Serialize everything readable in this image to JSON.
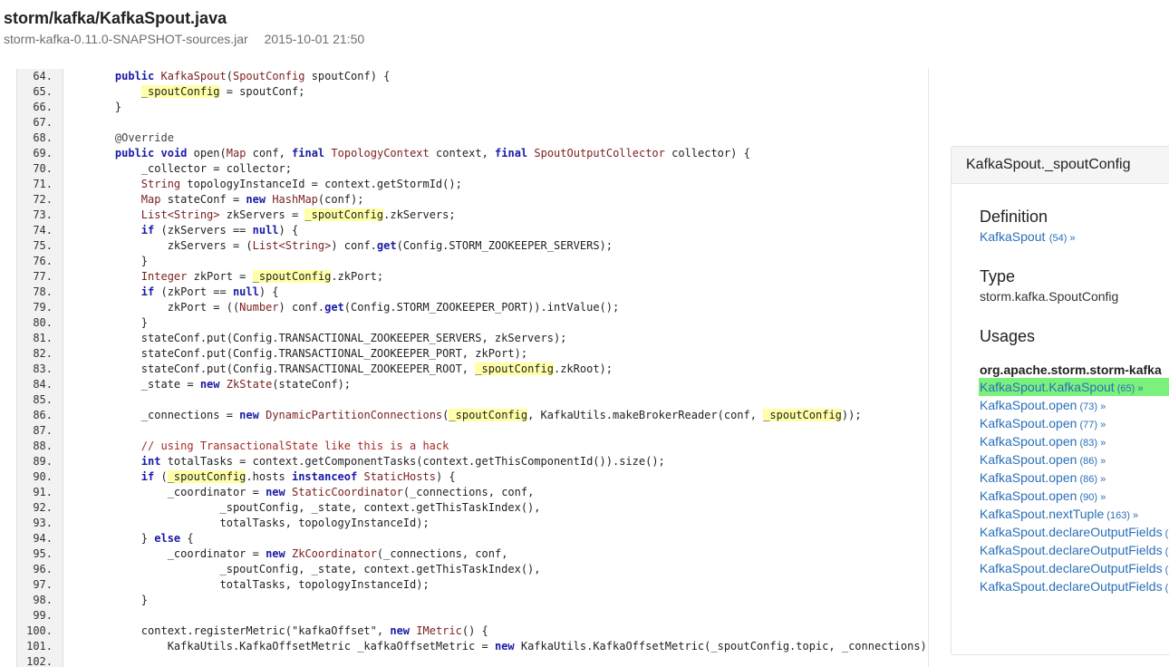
{
  "file": {
    "title": "storm/kafka/KafkaSpout.java",
    "jar": "storm-kafka-0.11.0-SNAPSHOT-sources.jar",
    "date": "2015-10-01 21:50"
  },
  "code_lines": [
    {
      "n": "64.",
      "t": [
        [
          "    "
        ],
        [
          "public",
          "kw"
        ],
        [
          " "
        ],
        [
          "KafkaSpout",
          "ty"
        ],
        [
          "("
        ],
        [
          "SpoutConfig",
          "ty"
        ],
        [
          " spoutConf) {"
        ]
      ]
    },
    {
      "n": "65.",
      "t": [
        [
          "        "
        ],
        [
          "_spoutConfig",
          "hl"
        ],
        [
          " = spoutConf;"
        ]
      ]
    },
    {
      "n": "66.",
      "t": [
        [
          "    }"
        ]
      ]
    },
    {
      "n": "67.",
      "t": [
        [
          ""
        ]
      ]
    },
    {
      "n": "68.",
      "t": [
        [
          "    "
        ],
        [
          "@Override",
          "an"
        ]
      ]
    },
    {
      "n": "69.",
      "t": [
        [
          "    "
        ],
        [
          "public",
          "kw"
        ],
        [
          " "
        ],
        [
          "void",
          "kw"
        ],
        [
          " open("
        ],
        [
          "Map",
          "ty"
        ],
        [
          " conf, "
        ],
        [
          "final",
          "kw"
        ],
        [
          " "
        ],
        [
          "TopologyContext",
          "ty"
        ],
        [
          " context, "
        ],
        [
          "final",
          "kw"
        ],
        [
          " "
        ],
        [
          "SpoutOutputCollector",
          "ty"
        ],
        [
          " collector) {"
        ]
      ]
    },
    {
      "n": "70.",
      "t": [
        [
          "        _collector = collector;"
        ]
      ]
    },
    {
      "n": "71.",
      "t": [
        [
          "        "
        ],
        [
          "String",
          "ty"
        ],
        [
          " topologyInstanceId = context.getStormId();"
        ]
      ]
    },
    {
      "n": "72.",
      "t": [
        [
          "        "
        ],
        [
          "Map",
          "ty"
        ],
        [
          " stateConf = "
        ],
        [
          "new",
          "kw"
        ],
        [
          " "
        ],
        [
          "HashMap",
          "ty"
        ],
        [
          "(conf);"
        ]
      ]
    },
    {
      "n": "73.",
      "t": [
        [
          "        "
        ],
        [
          "List<String>",
          "ty"
        ],
        [
          " zkServers = "
        ],
        [
          "_spoutConfig",
          "hl"
        ],
        [
          ".zkServers;"
        ]
      ]
    },
    {
      "n": "74.",
      "t": [
        [
          "        "
        ],
        [
          "if",
          "kw"
        ],
        [
          " (zkServers == "
        ],
        [
          "null",
          "kw"
        ],
        [
          ") {"
        ]
      ]
    },
    {
      "n": "75.",
      "t": [
        [
          "            zkServers = ("
        ],
        [
          "List<String>",
          "ty"
        ],
        [
          ") conf."
        ],
        [
          "get",
          "kw"
        ],
        [
          "(Config.STORM_ZOOKEEPER_SERVERS);"
        ]
      ]
    },
    {
      "n": "76.",
      "t": [
        [
          "        }"
        ]
      ]
    },
    {
      "n": "77.",
      "t": [
        [
          "        "
        ],
        [
          "Integer",
          "ty"
        ],
        [
          " zkPort = "
        ],
        [
          "_spoutConfig",
          "hl"
        ],
        [
          ".zkPort;"
        ]
      ]
    },
    {
      "n": "78.",
      "t": [
        [
          "        "
        ],
        [
          "if",
          "kw"
        ],
        [
          " (zkPort == "
        ],
        [
          "null",
          "kw"
        ],
        [
          ") {"
        ]
      ]
    },
    {
      "n": "79.",
      "t": [
        [
          "            zkPort = (("
        ],
        [
          "Number",
          "ty"
        ],
        [
          ") conf."
        ],
        [
          "get",
          "kw"
        ],
        [
          "(Config.STORM_ZOOKEEPER_PORT)).intValue();"
        ]
      ]
    },
    {
      "n": "80.",
      "t": [
        [
          "        }"
        ]
      ]
    },
    {
      "n": "81.",
      "t": [
        [
          "        stateConf.put(Config.TRANSACTIONAL_ZOOKEEPER_SERVERS, zkServers);"
        ]
      ]
    },
    {
      "n": "82.",
      "t": [
        [
          "        stateConf.put(Config.TRANSACTIONAL_ZOOKEEPER_PORT, zkPort);"
        ]
      ]
    },
    {
      "n": "83.",
      "t": [
        [
          "        stateConf.put(Config.TRANSACTIONAL_ZOOKEEPER_ROOT, "
        ],
        [
          "_spoutConfig",
          "hl"
        ],
        [
          ".zkRoot);"
        ]
      ]
    },
    {
      "n": "84.",
      "t": [
        [
          "        _state = "
        ],
        [
          "new",
          "kw"
        ],
        [
          " "
        ],
        [
          "ZkState",
          "ty"
        ],
        [
          "(stateConf);"
        ]
      ]
    },
    {
      "n": "85.",
      "t": [
        [
          ""
        ]
      ]
    },
    {
      "n": "86.",
      "t": [
        [
          "        _connections = "
        ],
        [
          "new",
          "kw"
        ],
        [
          " "
        ],
        [
          "DynamicPartitionConnections",
          "ty"
        ],
        [
          "("
        ],
        [
          "_spoutConfig",
          "hl"
        ],
        [
          ", KafkaUtils.makeBrokerReader(conf, "
        ],
        [
          "_spoutConfig",
          "hl"
        ],
        [
          "));"
        ]
      ]
    },
    {
      "n": "87.",
      "t": [
        [
          ""
        ]
      ]
    },
    {
      "n": "88.",
      "t": [
        [
          "        "
        ],
        [
          "// using TransactionalState like this is a hack",
          "cm"
        ]
      ]
    },
    {
      "n": "89.",
      "t": [
        [
          "        "
        ],
        [
          "int",
          "kw"
        ],
        [
          " totalTasks = context.getComponentTasks(context.getThisComponentId()).size();"
        ]
      ]
    },
    {
      "n": "90.",
      "t": [
        [
          "        "
        ],
        [
          "if",
          "kw"
        ],
        [
          " ("
        ],
        [
          "_spoutConfig",
          "hl"
        ],
        [
          ".hosts "
        ],
        [
          "instanceof",
          "kw"
        ],
        [
          " "
        ],
        [
          "StaticHosts",
          "ty"
        ],
        [
          ") {"
        ]
      ]
    },
    {
      "n": "91.",
      "t": [
        [
          "            _coordinator = "
        ],
        [
          "new",
          "kw"
        ],
        [
          " "
        ],
        [
          "StaticCoordinator",
          "ty"
        ],
        [
          "(_connections, conf,"
        ]
      ]
    },
    {
      "n": "92.",
      "t": [
        [
          "                    _spoutConfig, _state, context.getThisTaskIndex(),"
        ]
      ]
    },
    {
      "n": "93.",
      "t": [
        [
          "                    totalTasks, topologyInstanceId);"
        ]
      ]
    },
    {
      "n": "94.",
      "t": [
        [
          "        } "
        ],
        [
          "else",
          "kw"
        ],
        [
          " {"
        ]
      ]
    },
    {
      "n": "95.",
      "t": [
        [
          "            _coordinator = "
        ],
        [
          "new",
          "kw"
        ],
        [
          " "
        ],
        [
          "ZkCoordinator",
          "ty"
        ],
        [
          "(_connections, conf,"
        ]
      ]
    },
    {
      "n": "96.",
      "t": [
        [
          "                    _spoutConfig, _state, context.getThisTaskIndex(),"
        ]
      ]
    },
    {
      "n": "97.",
      "t": [
        [
          "                    totalTasks, topologyInstanceId);"
        ]
      ]
    },
    {
      "n": "98.",
      "t": [
        [
          "        }"
        ]
      ]
    },
    {
      "n": "99.",
      "t": [
        [
          ""
        ]
      ]
    },
    {
      "n": "100.",
      "t": [
        [
          "        context.registerMetric(\"kafkaOffset\", "
        ],
        [
          "new",
          "kw"
        ],
        [
          " "
        ],
        [
          "IMetric",
          "ty"
        ],
        [
          "() {"
        ]
      ]
    },
    {
      "n": "101.",
      "t": [
        [
          "            KafkaUtils.KafkaOffsetMetric _kafkaOffsetMetric = "
        ],
        [
          "new",
          "kw"
        ],
        [
          " KafkaUtils.KafkaOffsetMetric(_spoutConfig.topic, _connections);"
        ]
      ]
    },
    {
      "n": "102.",
      "t": [
        [
          ""
        ]
      ]
    }
  ],
  "side_panel": {
    "title": "KafkaSpout._spoutConfig",
    "definition_heading": "Definition",
    "definition_link": {
      "label": "KafkaSpout",
      "count": "(54) »"
    },
    "type_heading": "Type",
    "type_value": "storm.kafka.SpoutConfig",
    "usages_heading": "Usages",
    "usage_group": "org.apache.storm.storm-kafka",
    "usages": [
      {
        "label": "KafkaSpout.KafkaSpout",
        "count": "(65) »",
        "active": true
      },
      {
        "label": "KafkaSpout.open",
        "count": "(73) »",
        "active": false
      },
      {
        "label": "KafkaSpout.open",
        "count": "(77) »",
        "active": false
      },
      {
        "label": "KafkaSpout.open",
        "count": "(83) »",
        "active": false
      },
      {
        "label": "KafkaSpout.open",
        "count": "(86) »",
        "active": false
      },
      {
        "label": "KafkaSpout.open",
        "count": "(86) »",
        "active": false
      },
      {
        "label": "KafkaSpout.open",
        "count": "(90) »",
        "active": false
      },
      {
        "label": "KafkaSpout.nextTuple",
        "count": "(163) »",
        "active": false
      },
      {
        "label": "KafkaSpout.declareOutputFields",
        "count": "(",
        "active": false
      },
      {
        "label": "KafkaSpout.declareOutputFields",
        "count": "(",
        "active": false
      },
      {
        "label": "KafkaSpout.declareOutputFields",
        "count": "(",
        "active": false
      },
      {
        "label": "KafkaSpout.declareOutputFields",
        "count": "(",
        "active": false
      }
    ]
  },
  "colors": {
    "keyword": "#1a1aa6",
    "type": "#7a1f1f",
    "highlight": "#ffffa8",
    "link": "#2a6fb8",
    "active_usage": "#7cf07c"
  }
}
